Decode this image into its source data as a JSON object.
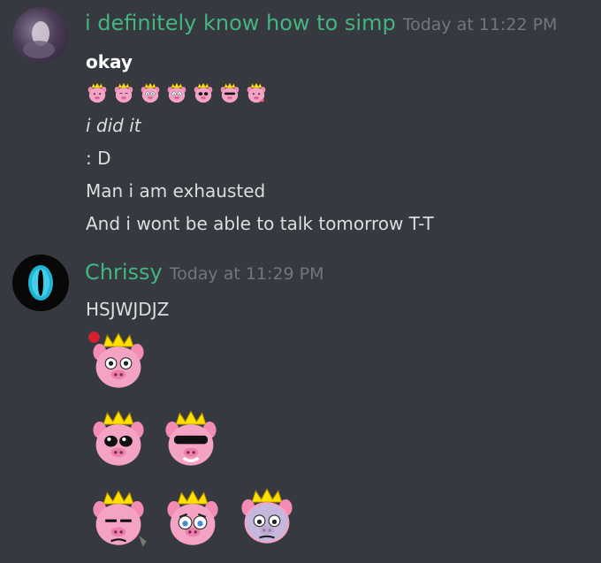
{
  "messages": [
    {
      "username": "i definitely know how to simp",
      "timestamp": "Today at 11:22 PM",
      "name_color": "#43b581",
      "lines": [
        {
          "text": "okay"
        },
        {
          "text": "i did it"
        },
        {
          "text": ": D"
        },
        {
          "text": "Man i am exhausted"
        },
        {
          "text": "And i wont be able to talk tomorrow T-T"
        }
      ],
      "inline_emotes": [
        "pig-crown-emote",
        "pig-crown-emote",
        "pig-crown-emote",
        "pig-crown-emote",
        "pig-crown-emote",
        "pig-crown-emote",
        "pig-crown-emote"
      ]
    },
    {
      "username": "Chrissy",
      "timestamp": "Today at 11:29 PM",
      "name_color": "#43b581",
      "lines": [
        {
          "text": "HSJWJDJZ"
        }
      ],
      "large_emotes": [
        "pig-crown-rose-emote",
        "pig-crown-eyes-emote",
        "pig-crown-shades-emote",
        "pig-crown-grumpy-emote",
        "pig-crown-crying-emote",
        "pig-crown-blue-emote"
      ]
    }
  ],
  "colors": {
    "background": "#36393f",
    "text": "#dcddde",
    "timestamp": "#72767d",
    "username": "#43b581",
    "pig_pink": "#f28cb5",
    "crown_yellow": "#ffe000"
  }
}
